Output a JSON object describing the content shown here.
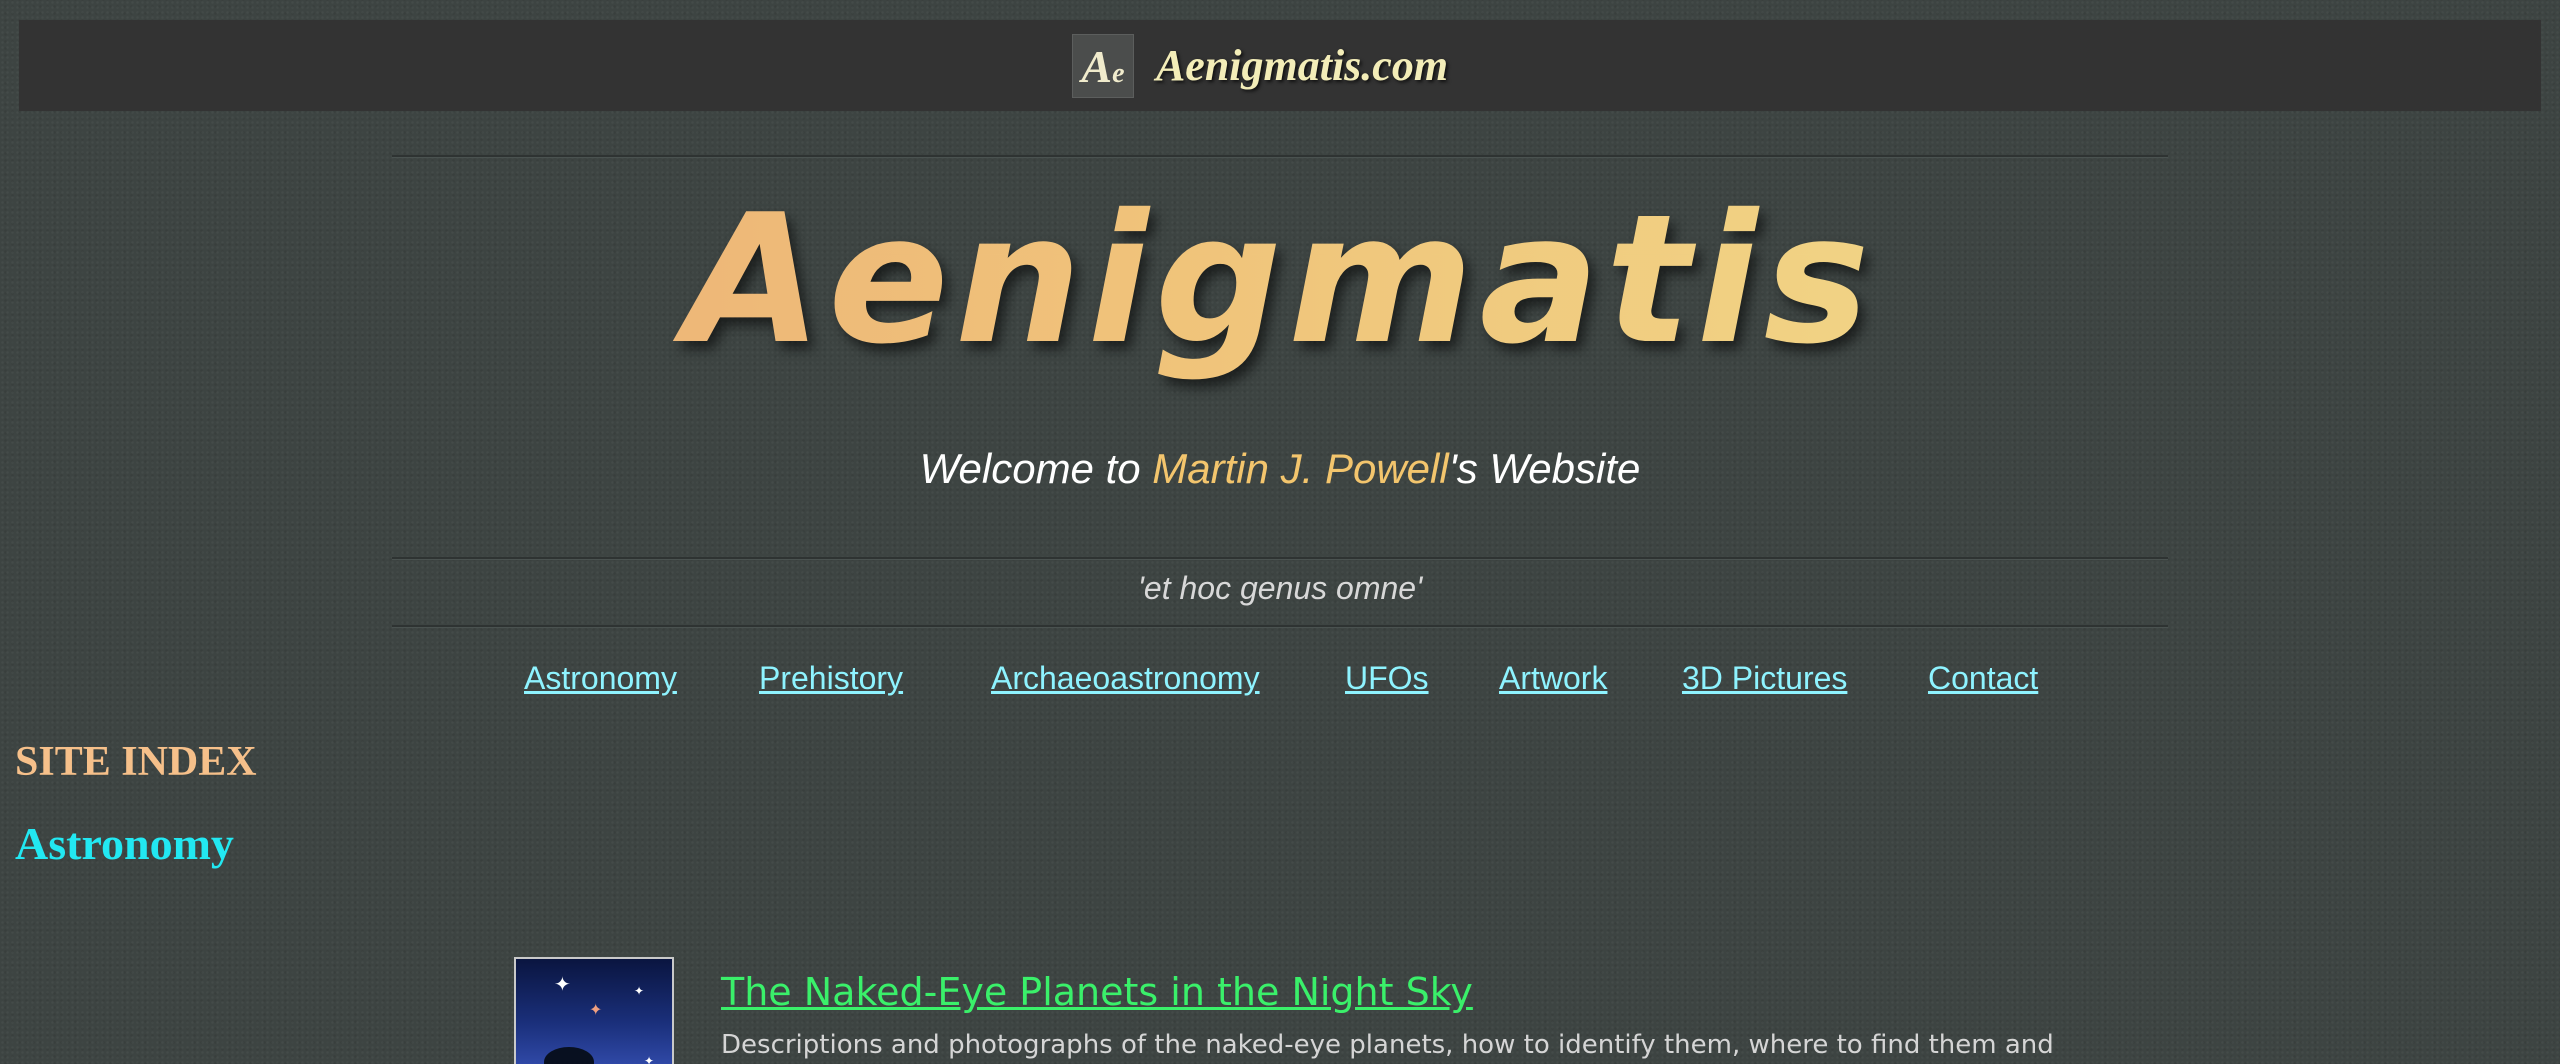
{
  "header": {
    "logo_letter_a": "A",
    "logo_letter_e": "e",
    "site_name": "Aenigmatis.com"
  },
  "banner": {
    "title": "Aenigmatis"
  },
  "welcome": {
    "prefix": "Welcome to ",
    "name": "Martin J. Powell",
    "suffix": "'s Website"
  },
  "motto": "'et hoc genus omne'",
  "nav": {
    "items": [
      {
        "label": "Astronomy"
      },
      {
        "label": "Prehistory"
      },
      {
        "label": "Archaeoastronomy"
      },
      {
        "label": "UFOs"
      },
      {
        "label": "Artwork"
      },
      {
        "label": "3D Pictures"
      },
      {
        "label": "Contact"
      }
    ]
  },
  "site_index": {
    "heading": "SITE INDEX",
    "section": "Astronomy"
  },
  "articles": [
    {
      "title": "The Naked-Eye Planets in the Night Sky",
      "description": "Descriptions and photographs of the naked-eye planets, how to identify them, where to find them and"
    }
  ],
  "colors": {
    "background": "#3d4442",
    "topbar": "#333333",
    "nav_link": "#8ef3ff",
    "site_index_heading": "#f6c08a",
    "section_heading": "#22e8f2",
    "article_link": "#3af06a",
    "name_highlight": "#f3c56d"
  }
}
